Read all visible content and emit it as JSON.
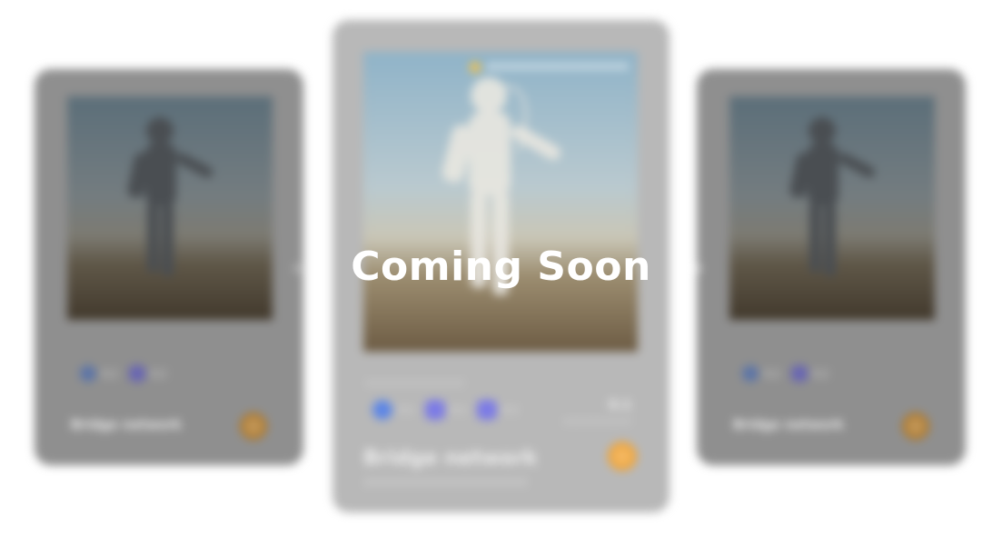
{
  "overlay": {
    "title": "Coming Soon"
  },
  "carousel": {
    "prev_icon": "chevron-left-icon",
    "next_icon": "chevron-right-icon",
    "cards": [
      {
        "position": "left",
        "name": "Bridge network",
        "chains": [
          {
            "icon": "circle-chain-icon",
            "color": "#5b74a8",
            "value": "0.2"
          },
          {
            "icon": "square-chain-icon",
            "color": "#6865b3",
            "value": "0.2"
          }
        ]
      },
      {
        "position": "center",
        "badge": "#################",
        "label": "#############",
        "name": "Bridge network",
        "subtext": "##################",
        "right_value": "0.1",
        "right_label": "##########",
        "chains": [
          {
            "icon": "circle-chain-icon",
            "color": "#5d86e6",
            "value": "0.2"
          },
          {
            "icon": "square-chain-icon",
            "color": "#7c7be6",
            "value": "0.2"
          },
          {
            "icon": "square-chain-icon",
            "color": "#7c7be6",
            "value": "0.2"
          }
        ]
      },
      {
        "position": "right",
        "name": "Bridge network",
        "chains": [
          {
            "icon": "circle-chain-icon",
            "color": "#5b74a8",
            "value": "0.2"
          },
          {
            "icon": "square-chain-icon",
            "color": "#6865b3",
            "value": "0.2"
          }
        ]
      }
    ]
  },
  "colors": {
    "action": "#f0a53a",
    "side_card": "#8f8f8f",
    "center_card": "#b8b8b8"
  }
}
